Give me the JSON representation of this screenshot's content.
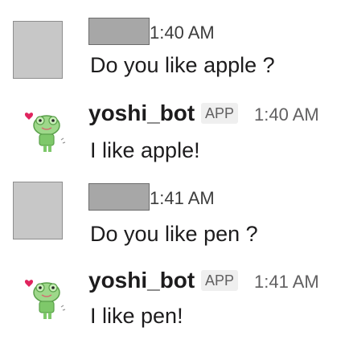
{
  "messages": [
    {
      "time": "1:40 AM",
      "text": "Do you like apple ?"
    },
    {
      "name": "yoshi_bot",
      "badge": "APP",
      "time": "1:40 AM",
      "text": "I like apple!"
    },
    {
      "time": "1:41 AM",
      "text": "Do you like pen ?"
    },
    {
      "name": "yoshi_bot",
      "badge": "APP",
      "time": "1:41 AM",
      "text": "I like pen!"
    }
  ],
  "icons": {
    "bot_avatar": "frog-bot-avatar-icon"
  },
  "colors": {
    "heart": "#e0245e",
    "frog_green": "#7ec86a",
    "text": "#1d1c1d",
    "muted": "#616061"
  }
}
